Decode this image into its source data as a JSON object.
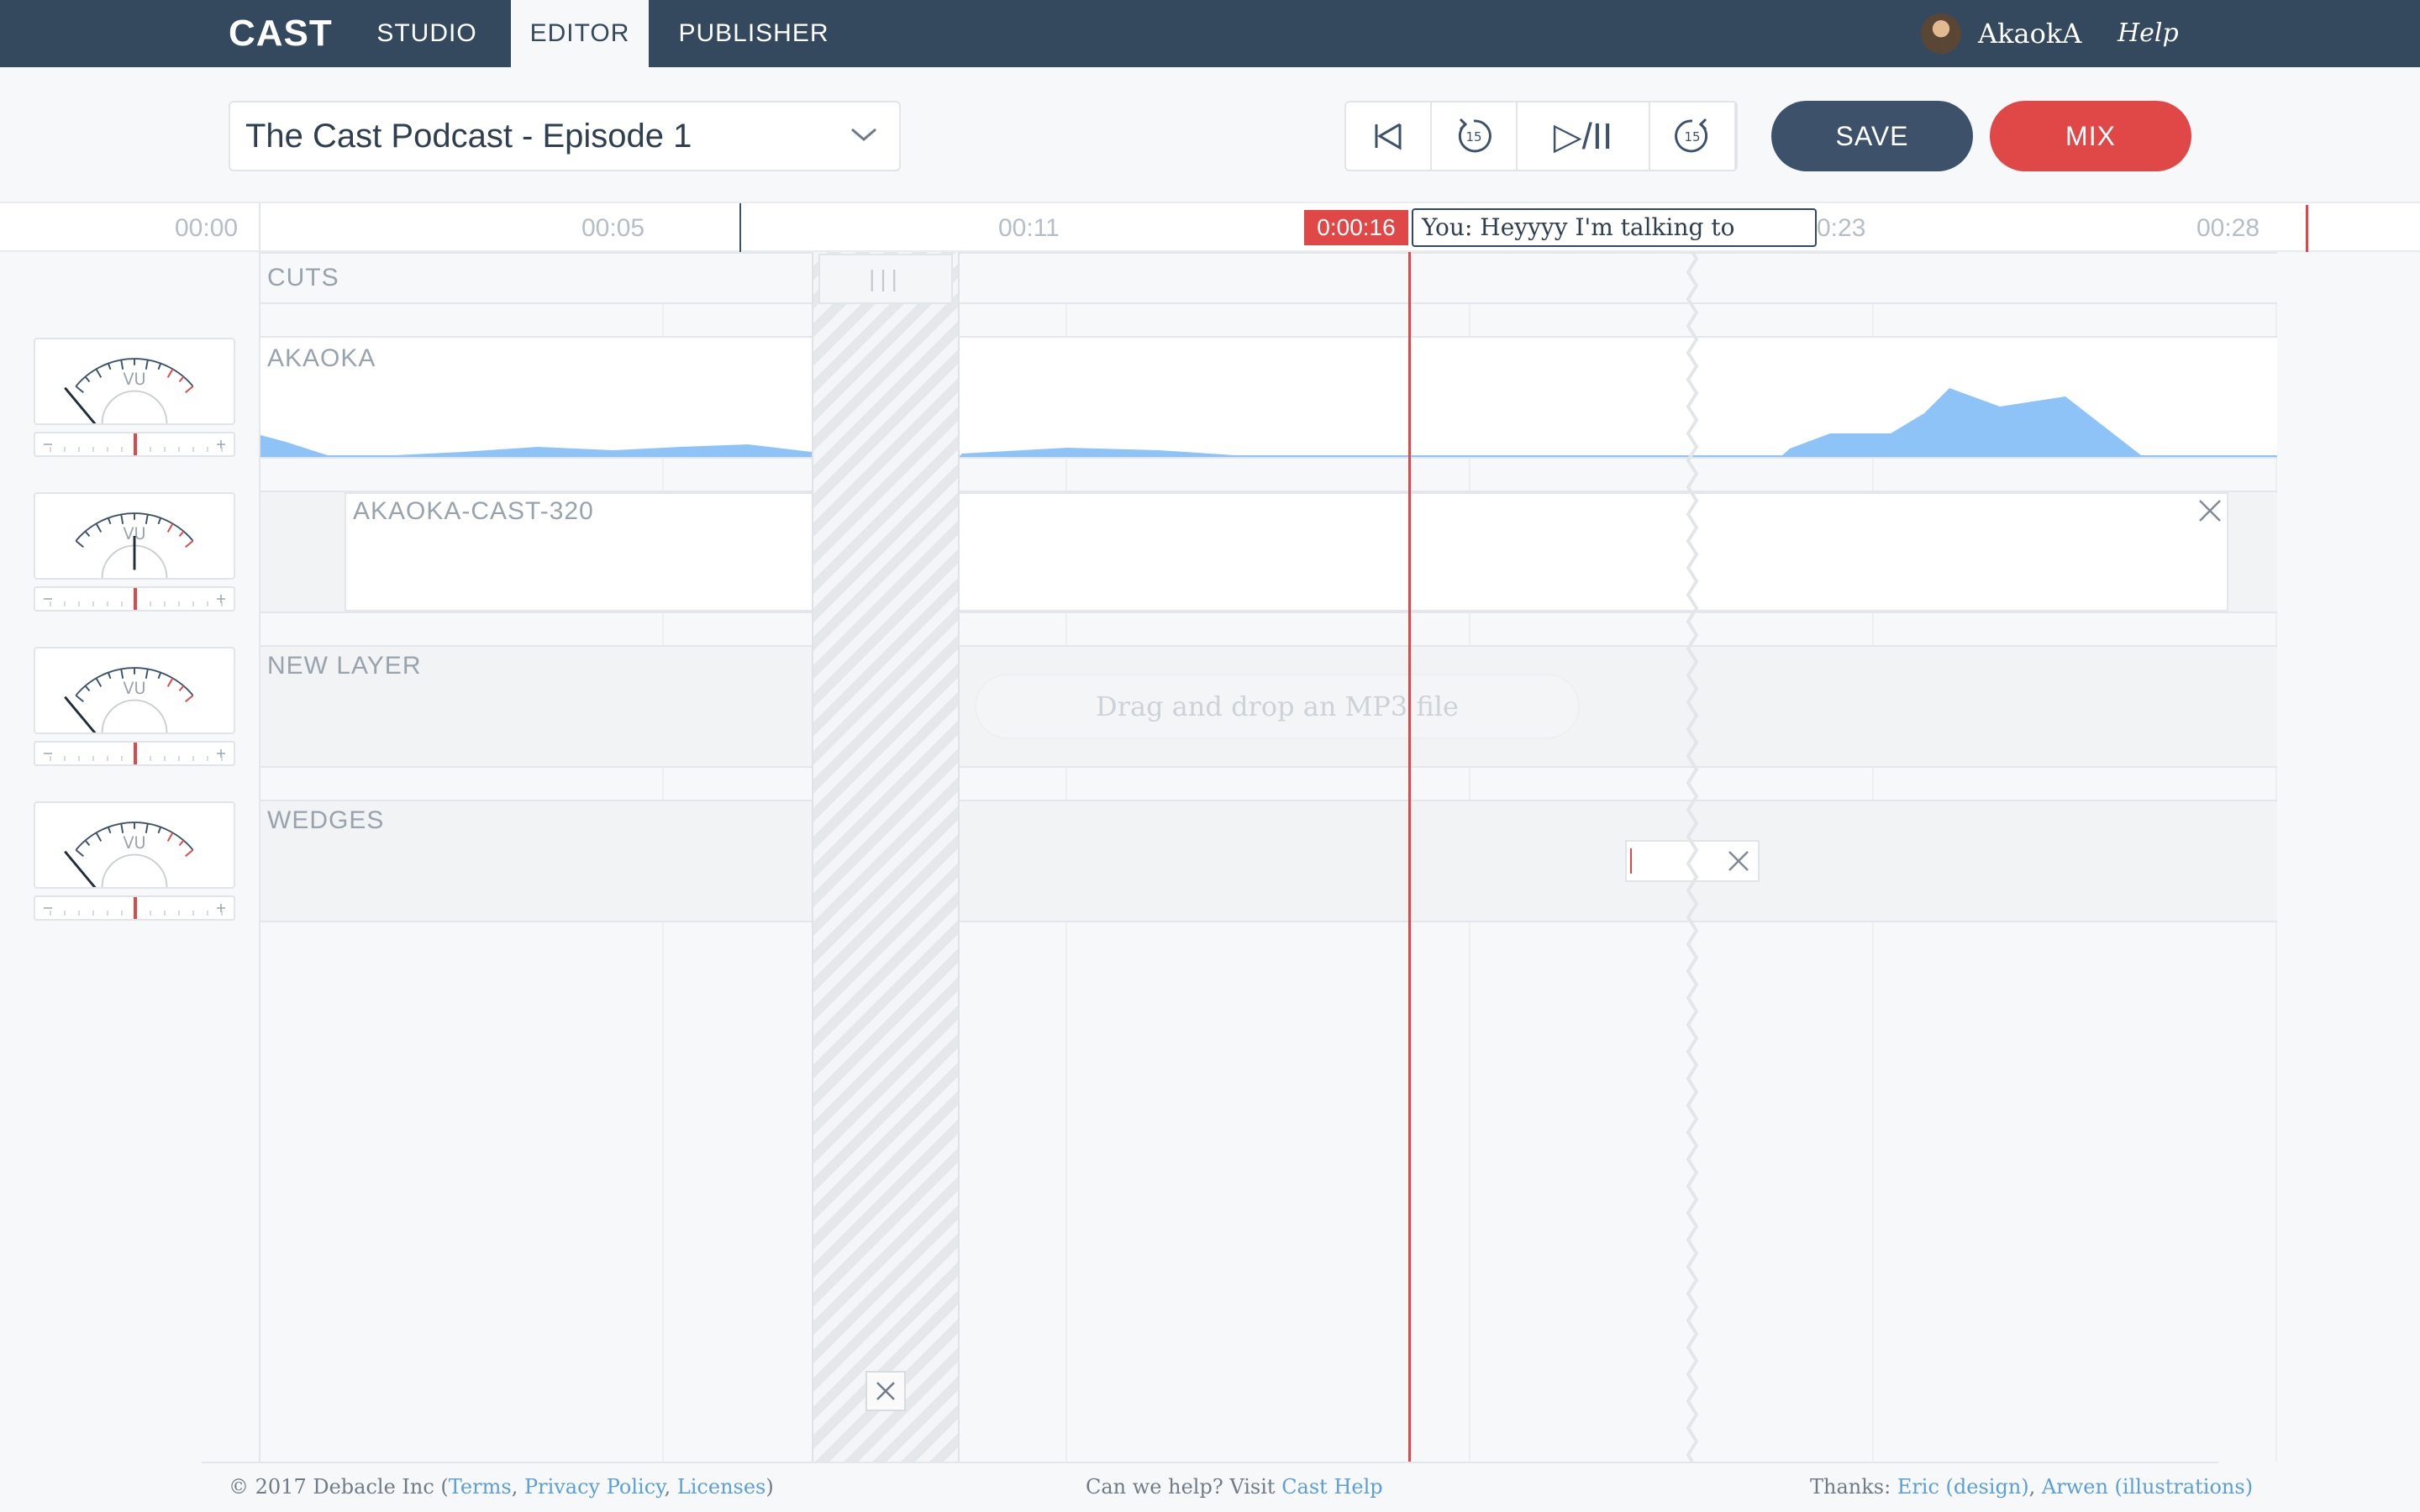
{
  "nav": {
    "logo": "CAST",
    "tabs": [
      {
        "label": "STUDIO"
      },
      {
        "label": "EDITOR"
      },
      {
        "label": "PUBLISHER"
      }
    ],
    "active_tab": "EDITOR",
    "user_name": "AkaokA",
    "help_label": "Help"
  },
  "toolbar": {
    "episode_title": "The Cast Podcast - Episode 1",
    "transport": {
      "skip_back_icon": "skip-to-start-icon",
      "rewind_icon": "rewind-15-icon",
      "play_pause_icon": "play-pause-icon",
      "forward_icon": "forward-15-icon",
      "play_pause_label": "▷/II",
      "rewind_seconds": "15",
      "forward_seconds": "15"
    },
    "save_label": "SAVE",
    "mix_label": "MIX"
  },
  "ruler": {
    "ticks": [
      "00:00",
      "00:05",
      "00:11",
      "0:23",
      "00:28"
    ],
    "playhead_time": "0:00:16",
    "comment": "You: Heyyyy I'm talking to myself!"
  },
  "tracks": {
    "cuts": {
      "label": "CUTS",
      "handle_label": "|||"
    },
    "akaoka": {
      "label": "AKAOKA"
    },
    "cast_clip": {
      "label": "AKAOKA-CAST-320"
    },
    "new_layer": {
      "label": "NEW LAYER",
      "drop_hint": "Drag and drop an MP3 file"
    },
    "wedges": {
      "label": "WEDGES"
    }
  },
  "vu_meter": {
    "label": "VU"
  },
  "colors": {
    "nav_bg": "#34495e",
    "accent_red": "#e04848",
    "save_btn": "#3d526a",
    "waveform": "#8ec3f8",
    "link": "#5a9fd8"
  },
  "footer": {
    "copyright": "© 2017 Debacle Inc (",
    "terms": "Terms",
    "privacy": "Privacy Policy",
    "licenses": "Licenses",
    "help_prefix": "Can we help? Visit ",
    "help_link": "Cast Help",
    "thanks_prefix": "Thanks: ",
    "thanks_eric": "Eric (design)",
    "thanks_arwen": "Arwen (illustrations)"
  }
}
